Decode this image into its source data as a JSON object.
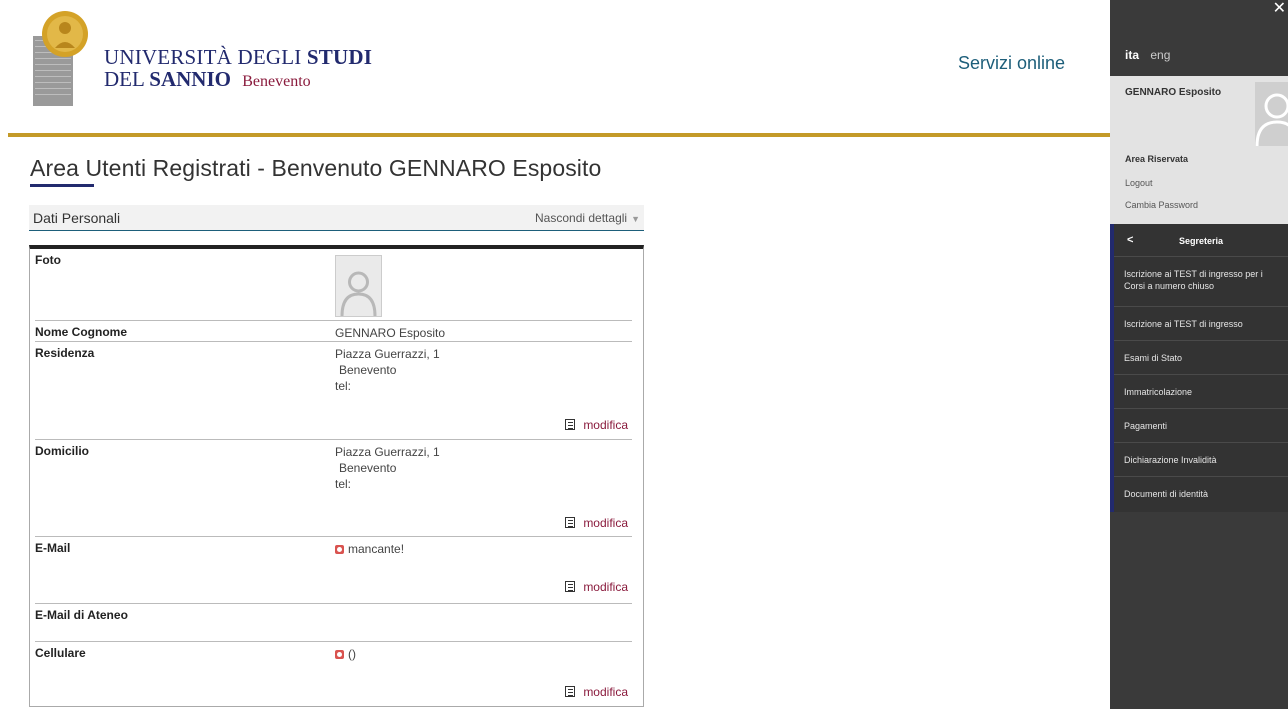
{
  "header": {
    "logo_line1_a": "UNIVERSITÀ",
    "logo_line1_b": "DEGLI",
    "logo_line1_c": "STUDI",
    "logo_line2_a": "DEL",
    "logo_line2_b": "SANNIO",
    "logo_line2_city": "Benevento",
    "servizi_label": "Servizi online"
  },
  "main": {
    "title": "Area Utenti Registrati - Benvenuto GENNARO Esposito",
    "section_title": "Dati Personali",
    "toggle_label": "Nascondi dettagli",
    "edit_label": "modifica",
    "rows": {
      "foto": {
        "label": "Foto"
      },
      "nome": {
        "label": "Nome Cognome",
        "value": "GENNARO Esposito"
      },
      "residenza": {
        "label": "Residenza",
        "line1": "Piazza Guerrazzi, 1",
        "line2": "Benevento",
        "line3": "tel:"
      },
      "domicilio": {
        "label": "Domicilio",
        "line1": "Piazza Guerrazzi, 1",
        "line2": "Benevento",
        "line3": "tel:"
      },
      "email": {
        "label": "E-Mail",
        "value": "mancante!"
      },
      "email_ateneo": {
        "label": "E-Mail di Ateneo"
      },
      "cellulare": {
        "label": "Cellulare",
        "value": "()"
      }
    }
  },
  "sidebar": {
    "lang_active": "ita",
    "lang_other": "eng",
    "user_name": "GENNARO Esposito",
    "area_title": "Area Riservata",
    "logout": "Logout",
    "change_password": "Cambia Password",
    "menu_back": "<",
    "menu_title": "Segreteria",
    "menu_items": [
      "Iscrizione ai TEST di ingresso per i Corsi a numero chiuso",
      "Iscrizione ai TEST di ingresso",
      "Esami di Stato",
      "Immatricolazione",
      "Pagamenti",
      "Dichiarazione Invalidità",
      "Documenti di identità"
    ]
  },
  "colors": {
    "brand_blue": "#222a6e",
    "gold": "#c49a28",
    "sidebar_bg": "#3a3a3a",
    "link_red": "#8a1b3d"
  }
}
